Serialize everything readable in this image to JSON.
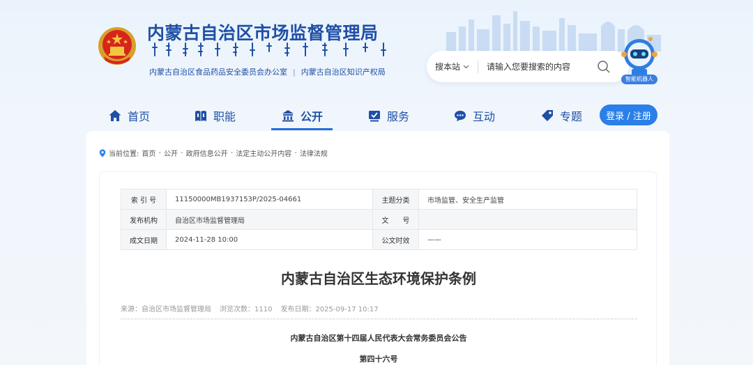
{
  "header": {
    "site_title": "内蒙古自治区市场监督管理局",
    "mongolian_title": "ᠥᠪᠥᠷ ᠮᠣᠩᠭᠣᠯ ᠤᠨ ᠵᠠᠰᠠᠭ ᠤᠨ ᠣᠷᠣᠨ ᠤ ᠵᠠᠬ᠎ᠠ ᠵᠡᠭᠡᠯᠢ",
    "sub_links": [
      "内蒙古自治区食品药品安全委员会办公室",
      "内蒙古自治区知识产权局"
    ],
    "sub_link_separator": "|"
  },
  "search": {
    "scope": "搜本站",
    "placeholder": "请输入您要搜索的内容"
  },
  "robot": {
    "label": "智能机器人"
  },
  "nav": {
    "items": [
      {
        "label": "首页",
        "icon": "home-icon"
      },
      {
        "label": "职能",
        "icon": "book-icon"
      },
      {
        "label": "公开",
        "icon": "building-icon",
        "active": true
      },
      {
        "label": "服务",
        "icon": "checklist-icon"
      },
      {
        "label": "互动",
        "icon": "chat-icon"
      },
      {
        "label": "专题",
        "icon": "tag-icon"
      }
    ],
    "login_label": "登录 / 注册"
  },
  "breadcrumb": {
    "prefix": "当前位置:",
    "items": [
      "首页",
      "公开",
      "政府信息公开",
      "法定主动公开内容",
      "法律法规"
    ],
    "separator": "-"
  },
  "meta": {
    "rows": [
      {
        "label1": "索 引 号",
        "value1": "11150000MB1937153P/2025-04661",
        "label2": "主题分类",
        "value2": "市场监管、安全生产监管"
      },
      {
        "label1": "发布机构",
        "value1": "自治区市场监督管理局",
        "label2": "文　　号",
        "value2": ""
      },
      {
        "label1": "成文日期",
        "value1": "2024-11-28 10:00",
        "label2": "公文时效",
        "value2": "——"
      }
    ]
  },
  "document": {
    "title": "内蒙古自治区生态环境保护条例",
    "source": "来源：自治区市场监督管理局",
    "views": "浏览次数：1110",
    "published": "发布日期：2025-09-17 10:17",
    "heading": "内蒙古自治区第十四届人民代表大会常务委员会公告",
    "number": "第四十六号"
  },
  "colors": {
    "brand_blue": "#1f4fa6",
    "accent_blue": "#2a7fe8",
    "page_bg": "#eaf3fc"
  }
}
